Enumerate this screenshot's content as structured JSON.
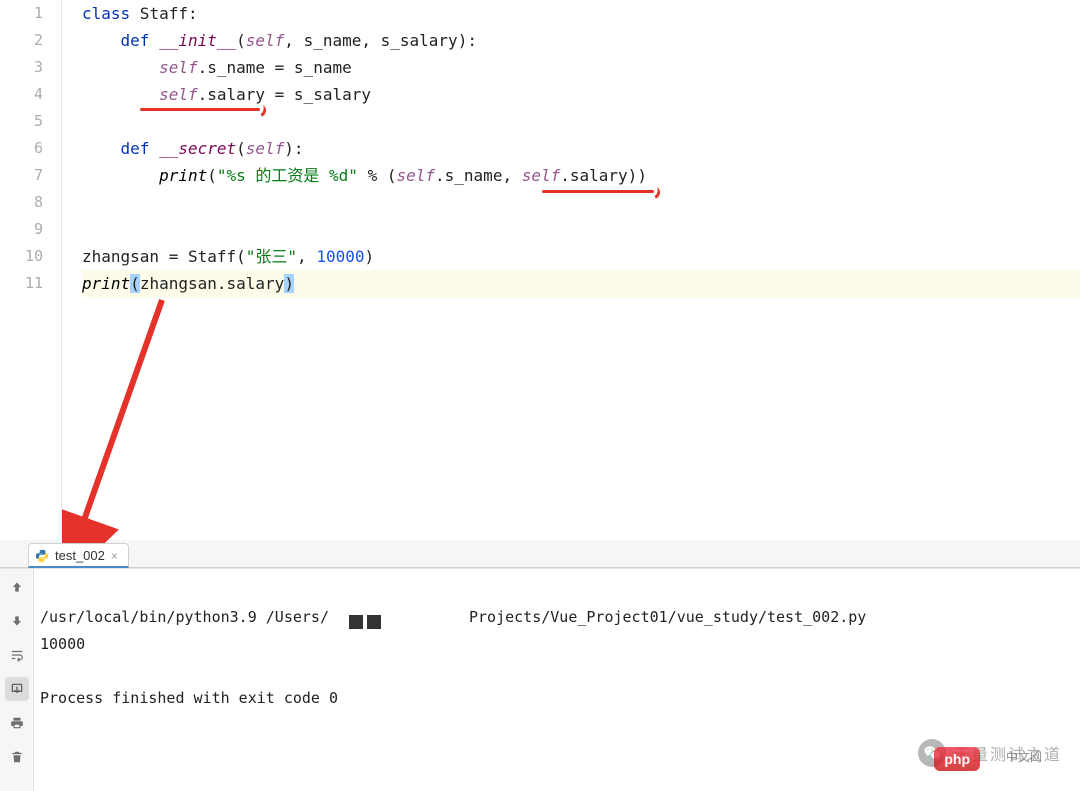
{
  "editor": {
    "lines": [
      {
        "n": "1"
      },
      {
        "n": "2"
      },
      {
        "n": "3"
      },
      {
        "n": "4"
      },
      {
        "n": "5"
      },
      {
        "n": "6"
      },
      {
        "n": "7"
      },
      {
        "n": "8"
      },
      {
        "n": "9"
      },
      {
        "n": "10"
      },
      {
        "n": "11"
      }
    ],
    "code": {
      "l1_kw1": "class",
      "l1_name": " Staff:",
      "l2_indent": "    ",
      "l2_kw": "def ",
      "l2_fn": "__init__",
      "l2_open": "(",
      "l2_self": "self",
      "l2_rest": ", s_name, s_salary):",
      "l3_indent": "        ",
      "l3_self": "self",
      "l3_rest": ".s_name = s_name",
      "l4_indent": "        ",
      "l4_self": "self",
      "l4_rest": ".salary = s_salary",
      "l6_indent": "    ",
      "l6_kw": "def ",
      "l6_fn": "__secret",
      "l6_open": "(",
      "l6_self": "self",
      "l6_rest": "):",
      "l7_indent": "        ",
      "l7_print": "print",
      "l7_open": "(",
      "l7_str": "\"%s 的工资是 %d\"",
      "l7_mid": " % (",
      "l7_self1": "self",
      "l7_mid2": ".s_name, ",
      "l7_self2": "self",
      "l7_rest": ".salary))",
      "l10_a": "zhangsan = Staff(",
      "l10_s": "\"张三\"",
      "l10_c": ", ",
      "l10_n": "10000",
      "l10_e": ")",
      "l11_print": "print",
      "l11_open": "(",
      "l11_arg": "zhangsan.salary",
      "l11_close": ")"
    }
  },
  "run_tab": {
    "label": "test_002",
    "close_label": "×"
  },
  "output": {
    "cmd_prefix": "/usr/local/bin/python3.9 /Users/",
    "cmd_suffix": "Projects/Vue_Project01/vue_study/test_002.py",
    "out_line2": "10000",
    "out_blank": "",
    "out_line3": "Process finished with exit code 0"
  },
  "toolbar": {
    "up": "up-arrow-icon",
    "down": "down-arrow-icon",
    "wrap": "wrap-icon",
    "export": "export-icon",
    "printer": "printer-icon",
    "trash": "trash-icon"
  },
  "watermark": {
    "text": "无量测试之道",
    "php": "php",
    "php_sub": "中文网"
  }
}
